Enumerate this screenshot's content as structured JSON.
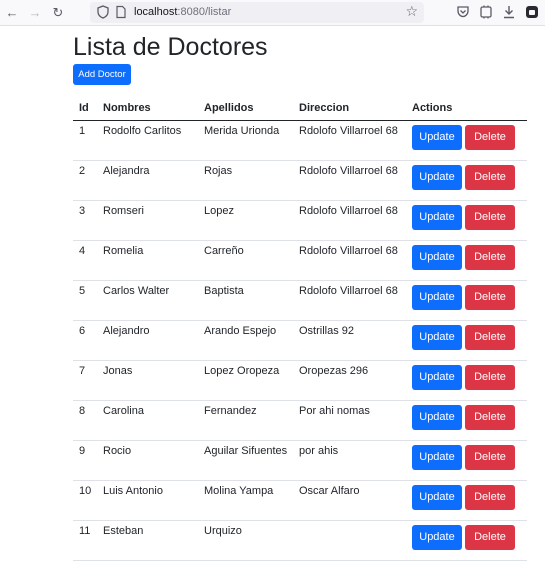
{
  "browser": {
    "url_host": "localhost",
    "url_rest": ":8080/listar"
  },
  "page": {
    "title": "Lista de Doctores",
    "add_button": "Add Doctor"
  },
  "table": {
    "headers": [
      "Id",
      "Nombres",
      "Apellidos",
      "Direccion",
      "Actions"
    ],
    "update_label": "Update",
    "delete_label": "Delete",
    "rows": [
      {
        "id": "1",
        "nombres": "Rodolfo Carlitos",
        "apellidos": "Merida Urionda",
        "direccion": "Rdolofo Villarroel 68"
      },
      {
        "id": "2",
        "nombres": "Alejandra",
        "apellidos": "Rojas",
        "direccion": "Rdolofo Villarroel 68"
      },
      {
        "id": "3",
        "nombres": "Romseri",
        "apellidos": "Lopez",
        "direccion": "Rdolofo Villarroel 68"
      },
      {
        "id": "4",
        "nombres": "Romelia",
        "apellidos": "Carreño",
        "direccion": "Rdolofo Villarroel 68"
      },
      {
        "id": "5",
        "nombres": "Carlos Walter",
        "apellidos": "Baptista",
        "direccion": "Rdolofo Villarroel 68"
      },
      {
        "id": "6",
        "nombres": "Alejandro",
        "apellidos": "Arando Espejo",
        "direccion": "Ostrillas 92"
      },
      {
        "id": "7",
        "nombres": "Jonas",
        "apellidos": "Lopez Oropeza",
        "direccion": "Oropezas 296"
      },
      {
        "id": "8",
        "nombres": "Carolina",
        "apellidos": "Fernandez",
        "direccion": "Por ahi nomas"
      },
      {
        "id": "9",
        "nombres": "Rocio",
        "apellidos": "Aguilar Sifuentes",
        "direccion": "por ahis"
      },
      {
        "id": "10",
        "nombres": "Luis Antonio",
        "apellidos": "Molina Yampa",
        "direccion": "Oscar Alfaro"
      },
      {
        "id": "11",
        "nombres": "Esteban",
        "apellidos": "Urquizo",
        "direccion": ""
      }
    ]
  }
}
